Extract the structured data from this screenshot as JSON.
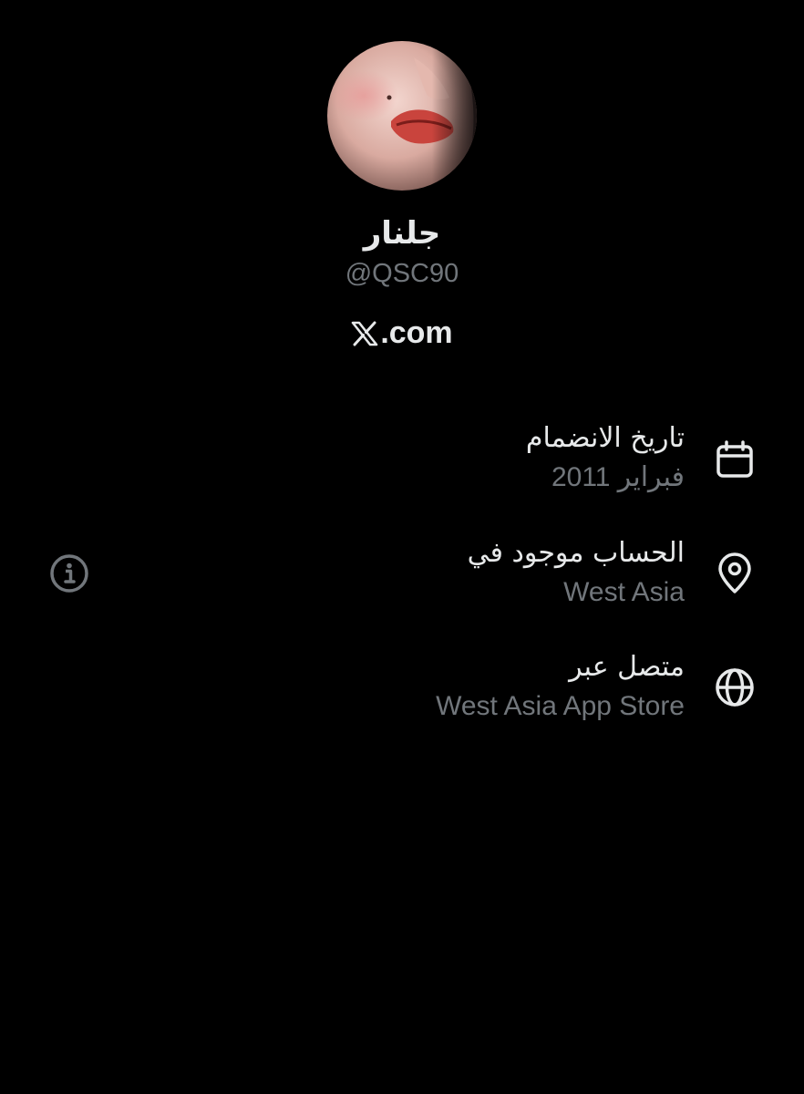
{
  "profile": {
    "display_name": "جلنار",
    "handle": "@QSC90",
    "brand_domain": ".com"
  },
  "details": {
    "joined": {
      "label": "تاريخ الانضمام",
      "value": "فبراير 2011",
      "icon": "calendar-icon"
    },
    "location": {
      "label": "الحساب موجود في",
      "value": "West Asia",
      "icon": "location-pin-icon"
    },
    "connected": {
      "label": "متصل عبر",
      "value": "West Asia App Store",
      "icon": "globe-icon"
    }
  },
  "info_button": {
    "icon": "info-icon"
  },
  "colors": {
    "background": "#000000",
    "primary_text": "#e7e9ea",
    "secondary_text": "#71767b"
  }
}
